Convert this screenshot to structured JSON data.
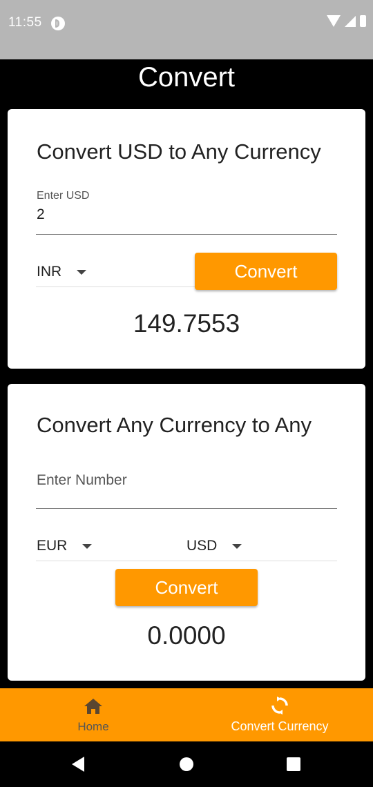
{
  "status_bar": {
    "time": "11:55"
  },
  "header": {
    "title": "Convert"
  },
  "card_usd": {
    "heading": "Convert USD to Any Currency",
    "input_label": "Enter USD",
    "input_value": "2",
    "target_currency": "INR",
    "convert_label": "Convert",
    "result": "149.7553"
  },
  "card_any": {
    "heading": "Convert Any Currency to Any",
    "input_placeholder": "Enter Number",
    "from_currency": "EUR",
    "to_currency": "USD",
    "convert_label": "Convert",
    "result": "0.0000"
  },
  "bottom_nav": {
    "items": [
      {
        "label": "Home",
        "icon": "home-icon",
        "active": false
      },
      {
        "label": "Convert Currency",
        "icon": "sync-icon",
        "active": true
      }
    ]
  },
  "colors": {
    "accent": "#ff9800",
    "status_bar": "#b6b6b6",
    "background": "#000000"
  }
}
